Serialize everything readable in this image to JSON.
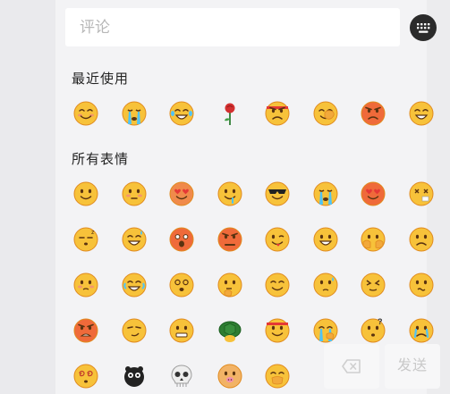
{
  "comment": {
    "placeholder": "评论"
  },
  "keyboard": {
    "icon": "keyboard-icon"
  },
  "sections": {
    "recent_title": "最近使用",
    "all_title": "所有表情"
  },
  "recent": [
    "blushing-smile",
    "crying-tears",
    "laughing-tears",
    "rose",
    "headband-angry",
    "face-palm",
    "red-angry",
    "grin"
  ],
  "all": [
    "smile",
    "pouting",
    "heart-eyes",
    "drooling",
    "sunglasses-cool",
    "crying-tears",
    "heart-eyes-red",
    "sick-cross",
    "sleepy",
    "sweat-laugh",
    "shocked-red",
    "angry-red",
    "tongue-wink",
    "big-grin",
    "peeking-hands",
    "sad-frown",
    "shy-blush",
    "tears-of-joy",
    "dizzy-eyes",
    "thinking-hand",
    "gentle-smile",
    "sweating",
    "crossed-eyes",
    "confused",
    "furious",
    "smirk-squint",
    "awkward-grin",
    "turtle",
    "headband",
    "crying-hand",
    "question-marks",
    "tearful",
    "swirl-eyes",
    "black-sheep",
    "skull",
    "pig-ears",
    "hand-over-mouth"
  ],
  "buttons": {
    "delete_icon": "backspace-icon",
    "send_label": "发送"
  },
  "colors": {
    "panel": "#f3f3f5",
    "emoji_face": "#f7c23a",
    "emoji_face_dark": "#e08a1e",
    "send_disabled": "#c9c9c9",
    "keyboard_bg": "#2b2b2b"
  }
}
